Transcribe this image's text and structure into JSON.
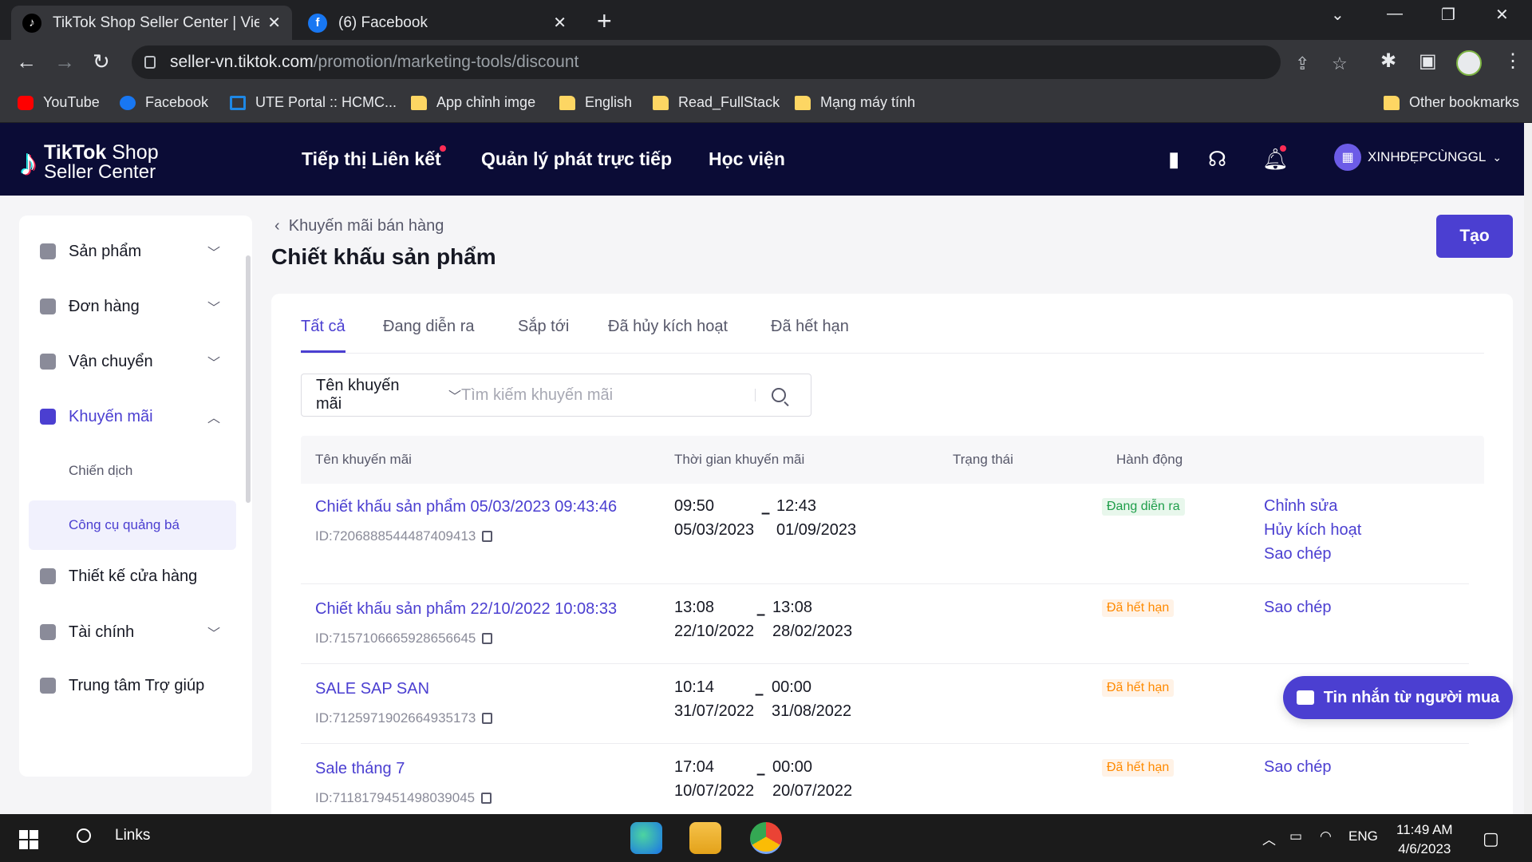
{
  "browser": {
    "tabs": [
      {
        "title": "TikTok Shop Seller Center | Vietna",
        "favicon": "tiktok-icon",
        "active": true
      },
      {
        "title": "(6) Facebook",
        "favicon": "facebook-icon",
        "active": false
      }
    ],
    "url_host": "seller-vn.tiktok.com",
    "url_path": "/promotion/marketing-tools/discount",
    "bookmarks": [
      {
        "label": "YouTube",
        "icon": "youtube-icon"
      },
      {
        "label": "Facebook",
        "icon": "facebook-icon"
      },
      {
        "label": "UTE Portal :: HCMC...",
        "icon": "ute-icon"
      },
      {
        "label": "App chỉnh imge",
        "icon": "folder-icon"
      },
      {
        "label": "English",
        "icon": "folder-icon"
      },
      {
        "label": "Read_FullStack",
        "icon": "folder-icon"
      },
      {
        "label": "Mạng máy tính",
        "icon": "folder-icon"
      }
    ],
    "other_bookmarks": "Other bookmarks"
  },
  "header": {
    "logo_line1_bold": "TikTok",
    "logo_line1_rest": " Shop",
    "logo_line2": "Seller Center",
    "nav": [
      "Tiếp thị Liên kết",
      "Quản lý phát trực tiếp",
      "Học viện"
    ],
    "account": "XINHĐẸPCÙNGGL"
  },
  "sidebar": {
    "items": [
      {
        "label": "Sản phẩm",
        "expandable": true
      },
      {
        "label": "Đơn hàng",
        "expandable": true
      },
      {
        "label": "Vận chuyển",
        "expandable": true
      },
      {
        "label": "Khuyến mãi",
        "expandable": true,
        "expanded": true
      },
      {
        "label": "Thiết kế cửa hàng",
        "expandable": false
      },
      {
        "label": "Tài chính",
        "expandable": true
      },
      {
        "label": "Trung tâm Trợ giúp",
        "expandable": false
      }
    ],
    "sub": [
      "Chiến dịch",
      "Công cụ quảng bá"
    ]
  },
  "page": {
    "breadcrumb": "Khuyến mãi bán hàng",
    "title": "Chiết khấu sản phẩm",
    "create_label": "Tạo",
    "tabs": [
      "Tất cả",
      "Đang diễn ra",
      "Sắp tới",
      "Đã hủy kích hoạt",
      "Đã hết hạn"
    ],
    "search_field": "Tên khuyến mãi",
    "search_placeholder": "Tìm kiếm khuyến mãi",
    "columns": [
      "Tên khuyến mãi",
      "Thời gian khuyến mãi",
      "Trạng thái",
      "Hành động"
    ],
    "rows": [
      {
        "name": "Chiết khấu sản phẩm 05/03/2023 09:43:46",
        "id": "ID:7206888544487409413",
        "start_time": "09:50",
        "start_date": "05/03/2023",
        "end_time": "12:43",
        "end_date": "01/09/2023",
        "status": "Đang diễn ra",
        "actions": [
          "Chỉnh sửa",
          "Hủy kích hoạt",
          "Sao chép"
        ]
      },
      {
        "name": "Chiết khấu sản phẩm 22/10/2022 10:08:33",
        "id": "ID:7157106665928656645",
        "start_time": "13:08",
        "start_date": "22/10/2022",
        "end_time": "13:08",
        "end_date": "28/02/2023",
        "status": "Đã hết hạn",
        "actions": [
          "Sao chép"
        ]
      },
      {
        "name": "SALE SAP SAN",
        "id": "ID:7125971902664935173",
        "start_time": "10:14",
        "start_date": "31/07/2022",
        "end_time": "00:00",
        "end_date": "31/08/2022",
        "status": "Đã hết hạn",
        "actions": []
      },
      {
        "name": "Sale tháng 7",
        "id": "ID:7118179451498039045",
        "start_time": "17:04",
        "start_date": "10/07/2022",
        "end_time": "00:00",
        "end_date": "20/07/2022",
        "status": "Đã hết hạn",
        "actions": [
          "Sao chép"
        ]
      }
    ],
    "chat_label": "Tin nhắn từ người mua"
  },
  "taskbar": {
    "search_label": "Links",
    "language": "ENG",
    "time": "11:49 AM",
    "date": "4/6/2023"
  },
  "colors": {
    "brand": "#4b3fd1",
    "header_bg": "#0b0c36",
    "active_badge": "#1e9e4a",
    "expired_badge": "#ff8a00"
  }
}
